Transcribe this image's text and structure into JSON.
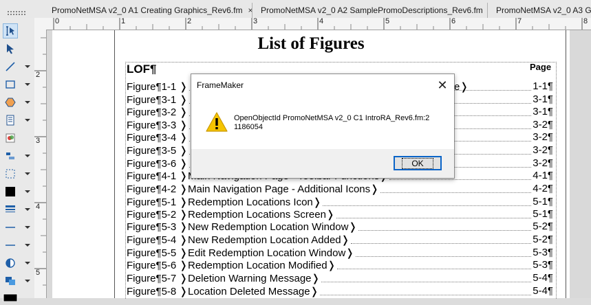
{
  "tabs": [
    {
      "label": "PromoNetMSA v2_0 A1 Creating Graphics_Rev6.fm"
    },
    {
      "label": "PromoNetMSA v2_0 A2 SamplePromoDescriptions_Rev6.fm"
    },
    {
      "label": "PromoNetMSA v2_0 A3 Gl"
    }
  ],
  "tab_close": "×",
  "ruler": {
    "h_numbers": [
      "0",
      "1",
      "2",
      "3",
      "4",
      "5",
      "6",
      "7",
      "8"
    ],
    "v_numbers": [
      "2",
      "3",
      "4",
      "5"
    ]
  },
  "document": {
    "title": "List of Figures",
    "lof_label": "LOF¶",
    "page_header": "Page",
    "rows": [
      {
        "label": "Figure¶1-1  ❭",
        "page": "1-1¶"
      },
      {
        "label": "Figure¶3-1  ❭",
        "page": "3-1¶"
      },
      {
        "label": "Figure¶3-2  ❭",
        "page": "3-1¶"
      },
      {
        "label": "Figure¶3-3  ❭",
        "page": "3-2¶"
      },
      {
        "label": "Figure¶3-4  ❭",
        "page": "3-2¶"
      },
      {
        "label": "Figure¶3-5  ❭",
        "page": "3-2¶"
      },
      {
        "label": "Figure¶3-6  ❭",
        "page": "3-2¶"
      },
      {
        "label": "Figure¶4-1  ❭Main Navigation Page - Toolbar Functions❭",
        "page": "4-1¶"
      },
      {
        "label": "Figure¶4-2  ❭Main Navigation Page - Additional Icons❭",
        "page": "4-2¶"
      },
      {
        "label": "Figure¶5-1  ❭Redemption Locations Icon❭",
        "page": "5-1¶"
      },
      {
        "label": "Figure¶5-2  ❭Redemption Locations Screen❭",
        "page": "5-1¶"
      },
      {
        "label": "Figure¶5-3  ❭New Redemption Location Window❭",
        "page": "5-2¶"
      },
      {
        "label": "Figure¶5-4  ❭New Redemption Location Added❭",
        "page": "5-2¶"
      },
      {
        "label": "Figure¶5-5  ❭Edit Redemption Location Window❭",
        "page": "5-3¶"
      },
      {
        "label": "Figure¶5-6  ❭Redemption Location Modified❭",
        "page": "5-3¶"
      },
      {
        "label": "Figure¶5-7  ❭Deletion Warning Message❭",
        "page": "5-4¶"
      },
      {
        "label": "Figure¶5-8  ❭Location Deleted Message❭",
        "page": "5-4¶"
      }
    ],
    "hidden_row_tail": "e❭"
  },
  "dialog": {
    "title": "FrameMaker",
    "close": "✕",
    "message_line1": "OpenObjectId PromoNetMSA v2_0 C1 IntroRA_Rev6.fm:2",
    "message_line2": "1186054",
    "ok_label": "OK"
  },
  "colors": {
    "accent": "#0a64c8",
    "warning": "#f5c400"
  }
}
